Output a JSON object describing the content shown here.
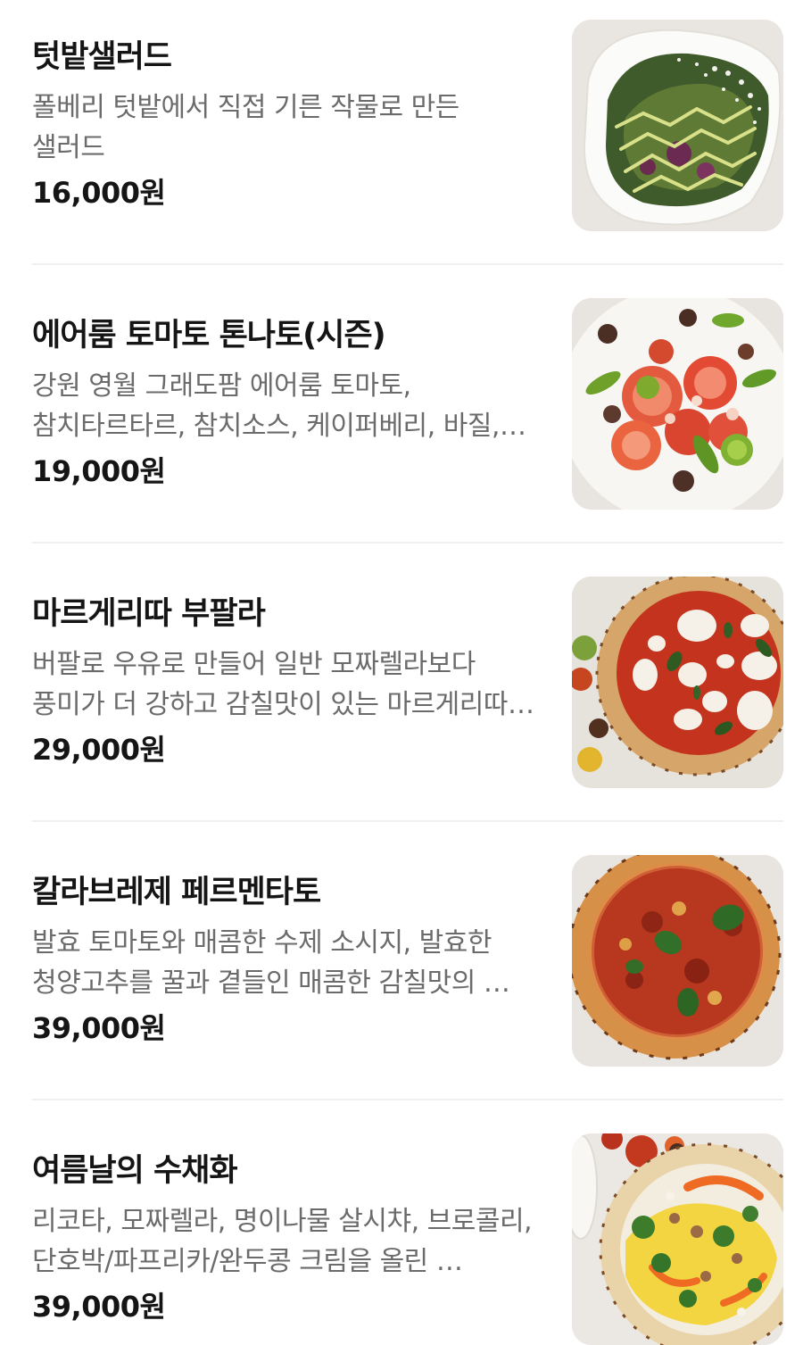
{
  "menu": {
    "items": [
      {
        "name": "텃밭샐러드",
        "description": "폴베리 텃밭에서 직접 기른 작물로 만든 샐러드",
        "price": "16,000원",
        "image": "salad-photo"
      },
      {
        "name": "에어룸 토마토 톤나토(시즌)",
        "description": "강원 영월 그래도팜 에어룸 토마토, 참치타르타르, 참치소스, 케이퍼베리, 바질, 올리…",
        "price": "19,000원",
        "image": "tomato-tonnato-photo"
      },
      {
        "name": "마르게리따 부팔라",
        "description": "버팔로 우유로 만들어 일반 모짜렐라보다 풍미가 더 강하고 감칠맛이 있는 마르게리따…",
        "price": "29,000원",
        "image": "margherita-pizza-photo"
      },
      {
        "name": "칼라브레제 페르멘타토",
        "description": "발효 토마토와 매콤한 수제 소시지, 발효한 청양고추를 꿀과 곁들인 매콤한 감칠맛의 …",
        "price": "39,000원",
        "image": "calabrese-pizza-photo"
      },
      {
        "name": "여름날의 수채화",
        "description": "리코타, 모짜렐라, 명이나물 살시챠, 브로콜리, 단호박/파프리카/완두콩 크림을 올린 …",
        "price": "39,000원",
        "image": "summer-pizza-photo"
      }
    ]
  }
}
